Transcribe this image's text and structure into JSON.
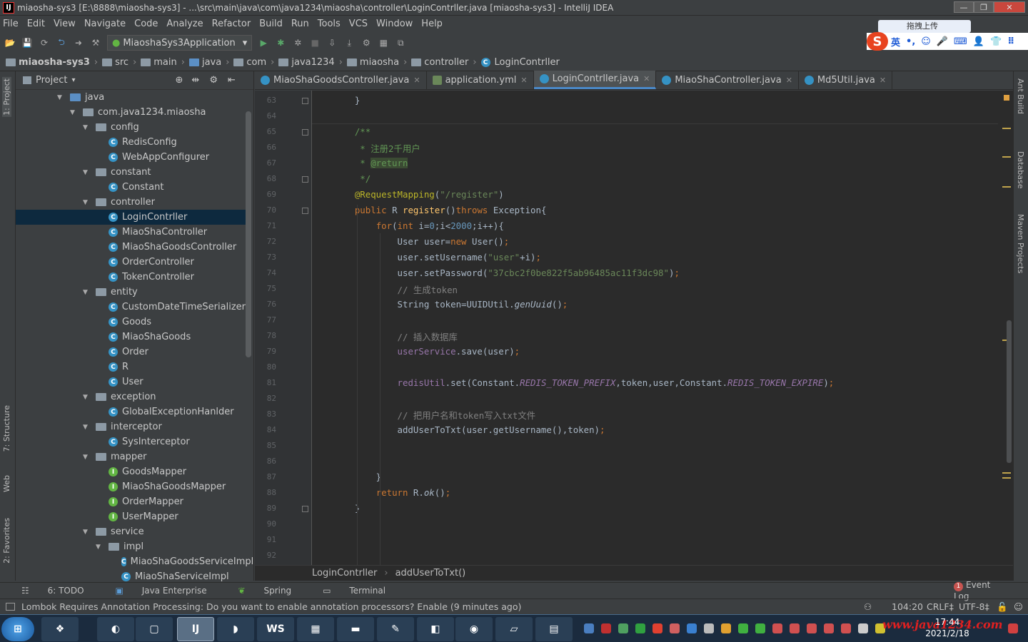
{
  "window": {
    "title": "miaosha-sys3 [E:\\8888\\miaosha-sys3] - ...\\src\\main\\java\\com\\java1234\\miaosha\\controller\\LoginContrller.java [miaosha-sys3] - IntelliJ IDEA",
    "min_label": "—",
    "max_label": "❐",
    "close_label": "✕"
  },
  "menu": [
    "File",
    "Edit",
    "View",
    "Navigate",
    "Code",
    "Analyze",
    "Refactor",
    "Build",
    "Run",
    "Tools",
    "VCS",
    "Window",
    "Help"
  ],
  "ime": {
    "tooltip": "拖拽上传",
    "logo": "S",
    "items": [
      "英",
      "•,",
      "☺",
      "🎤",
      "⌨",
      "👤",
      "👕",
      "⠿"
    ]
  },
  "toolbar": {
    "run_config": "MiaoshaSys3Application"
  },
  "navbar": {
    "crumbs": [
      "miaosha-sys3",
      "src",
      "main",
      "java",
      "com",
      "java1234",
      "miaosha",
      "controller",
      "LoginContrller"
    ]
  },
  "left_strip": {
    "project": "1: Project",
    "structure": "7: Structure",
    "web": "Web",
    "favorites": "2: Favorites"
  },
  "right_strip": {
    "ant": "Ant Build",
    "database": "Database",
    "maven": "Maven Projects"
  },
  "project_panel": {
    "title": "Project",
    "nodes": [
      {
        "label": "java",
        "kind": "folder",
        "depth": 0,
        "open": true
      },
      {
        "label": "com.java1234.miaosha",
        "kind": "folder",
        "depth": 1,
        "open": true
      },
      {
        "label": "config",
        "kind": "folder",
        "depth": 2,
        "open": true
      },
      {
        "label": "RedisConfig",
        "kind": "class",
        "depth": 3
      },
      {
        "label": "WebAppConfigurer",
        "kind": "class",
        "depth": 3
      },
      {
        "label": "constant",
        "kind": "folder",
        "depth": 2,
        "open": true
      },
      {
        "label": "Constant",
        "kind": "class",
        "depth": 3
      },
      {
        "label": "controller",
        "kind": "folder",
        "depth": 2,
        "open": true
      },
      {
        "label": "LoginContrller",
        "kind": "class",
        "depth": 3,
        "selected": true
      },
      {
        "label": "MiaoShaController",
        "kind": "class",
        "depth": 3
      },
      {
        "label": "MiaoShaGoodsController",
        "kind": "class",
        "depth": 3
      },
      {
        "label": "OrderController",
        "kind": "class",
        "depth": 3
      },
      {
        "label": "TokenController",
        "kind": "class",
        "depth": 3
      },
      {
        "label": "entity",
        "kind": "folder",
        "depth": 2,
        "open": true
      },
      {
        "label": "CustomDateTimeSerializer",
        "kind": "class",
        "depth": 3
      },
      {
        "label": "Goods",
        "kind": "class",
        "depth": 3
      },
      {
        "label": "MiaoShaGoods",
        "kind": "class",
        "depth": 3
      },
      {
        "label": "Order",
        "kind": "class",
        "depth": 3
      },
      {
        "label": "R",
        "kind": "class",
        "depth": 3
      },
      {
        "label": "User",
        "kind": "class",
        "depth": 3
      },
      {
        "label": "exception",
        "kind": "folder",
        "depth": 2,
        "open": true
      },
      {
        "label": "GlobalExceptionHanlder",
        "kind": "class",
        "depth": 3
      },
      {
        "label": "interceptor",
        "kind": "folder",
        "depth": 2,
        "open": true
      },
      {
        "label": "SysInterceptor",
        "kind": "class",
        "depth": 3
      },
      {
        "label": "mapper",
        "kind": "folder",
        "depth": 2,
        "open": true
      },
      {
        "label": "GoodsMapper",
        "kind": "interface",
        "depth": 3
      },
      {
        "label": "MiaoShaGoodsMapper",
        "kind": "interface",
        "depth": 3
      },
      {
        "label": "OrderMapper",
        "kind": "interface",
        "depth": 3
      },
      {
        "label": "UserMapper",
        "kind": "interface",
        "depth": 3
      },
      {
        "label": "service",
        "kind": "folder",
        "depth": 2,
        "open": true
      },
      {
        "label": "impl",
        "kind": "folder",
        "depth": 3,
        "open": true
      },
      {
        "label": "MiaoShaGoodsServiceImpl",
        "kind": "class",
        "depth": 4
      },
      {
        "label": "MiaoShaServiceImpl",
        "kind": "class",
        "depth": 4
      }
    ]
  },
  "tabs": [
    {
      "label": "MiaoShaGoodsController.java",
      "icon": "class"
    },
    {
      "label": "application.yml",
      "icon": "yml"
    },
    {
      "label": "LoginContrller.java",
      "icon": "class",
      "active": true
    },
    {
      "label": "MiaoShaController.java",
      "icon": "class"
    },
    {
      "label": "Md5Util.java",
      "icon": "class"
    }
  ],
  "editor": {
    "lines": [
      {
        "n": "63",
        "html": "    <span>}</span>"
      },
      {
        "n": "64",
        "html": ""
      },
      {
        "n": "65",
        "html": "    <span class='doc'>/**</span>"
      },
      {
        "n": "66",
        "html": "<span class='doc'>     * 注册2千用户</span>"
      },
      {
        "n": "67",
        "html": "<span class='doc'>     * </span><span class='tag'>@return</span>"
      },
      {
        "n": "68",
        "html": "<span class='doc'>     */</span>"
      },
      {
        "n": "69",
        "html": "    <span class='ann'>@RequestMapping</span>(<span class='str'>\"/register\"</span>)"
      },
      {
        "n": "70",
        "html": "    <span class='kw'>public</span> R <span class='fn'>register</span>()<span class='kw'>throws</span> Exception{"
      },
      {
        "n": "71",
        "html": "        <span class='kw'>for</span>(<span class='kw'>int</span> i=<span class='num'>0</span>;i&lt;<span class='num'>2000</span>;i++){"
      },
      {
        "n": "72",
        "html": "            User user=<span class='kw'>new</span> User()<span class='kw'>;</span>"
      },
      {
        "n": "73",
        "html": "            user.setUsername(<span class='str'>\"user\"</span>+i)<span class='kw'>;</span>"
      },
      {
        "n": "74",
        "html": "            user.setPassword(<span class='str'>\"37cbc2f0be822f5ab96485ac11f3dc98\"</span>)<span class='kw'>;</span>"
      },
      {
        "n": "75",
        "html": "            <span class='cm'>// 生成token</span>"
      },
      {
        "n": "76",
        "html": "            String token=UUIDUtil.<span class='it'>genUuid</span>()<span class='kw'>;</span>"
      },
      {
        "n": "77",
        "html": ""
      },
      {
        "n": "78",
        "html": "            <span class='cm'>// 插入数据库</span>"
      },
      {
        "n": "79",
        "html": "            <span class='fld'>userService</span>.save(user)<span class='kw'>;</span>"
      },
      {
        "n": "80",
        "html": ""
      },
      {
        "n": "81",
        "html": "            <span class='fld'>redisUtil</span>.set(Constant.<span class='st'>REDIS_TOKEN_PREFIX</span>,token,user,Constant.<span class='st'>REDIS_TOKEN_EXPIRE</span>)<span class='kw'>;</span>"
      },
      {
        "n": "82",
        "html": ""
      },
      {
        "n": "83",
        "html": "            <span class='cm'>// 把用户名和token写入txt文件</span>"
      },
      {
        "n": "84",
        "html": "            addUserToTxt(user.getUsername(),token)<span class='kw'>;</span>"
      },
      {
        "n": "85",
        "html": ""
      },
      {
        "n": "86",
        "html": ""
      },
      {
        "n": "87",
        "html": "        }"
      },
      {
        "n": "88",
        "html": "        <span class='kw'>return</span> R.<span class='it'>ok</span>()<span class='kw'>;</span>"
      },
      {
        "n": "89",
        "html": "    }"
      },
      {
        "n": "90",
        "html": ""
      },
      {
        "n": "91",
        "html": ""
      },
      {
        "n": "92",
        "html": ""
      }
    ]
  },
  "breadcrumb": {
    "class": "LoginContrller",
    "method": "addUserToTxt()"
  },
  "toolwindows": {
    "todo": "6: TODO",
    "java_enterprise": "Java Enterprise",
    "spring": "Spring",
    "terminal": "Terminal",
    "event_log": "Event Log",
    "event_count": "1"
  },
  "status": {
    "message": "Lombok Requires Annotation Processing: Do you want to enable annotation processors? Enable (9 minutes ago)",
    "position": "104:20",
    "line_sep": "CRLF‡",
    "encoding": "UTF-8‡"
  },
  "taskbar": {
    "time": "17:44",
    "date": "2021/2/18",
    "watermark": "www.java1234.com"
  }
}
